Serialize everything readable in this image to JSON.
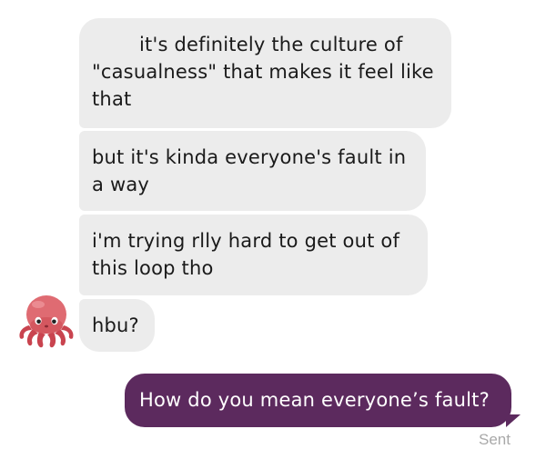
{
  "conversation": {
    "received_messages": [
      {
        "text": "it's definitely the culture of \"casualness\" that makes it feel like that"
      },
      {
        "text": "but it's kinda everyone's fault in a way"
      },
      {
        "text": "i'm trying rlly hard to get out of this loop tho"
      },
      {
        "text": "hbu?"
      }
    ],
    "sent_message": {
      "text": "How do you mean everyone’s fault?"
    },
    "status": "Sent",
    "avatar_icon": "octopus-icon"
  },
  "colors": {
    "received_bubble": "#ececec",
    "sent_bubble": "#5c2a5e",
    "status_text": "#a9a9a9"
  }
}
